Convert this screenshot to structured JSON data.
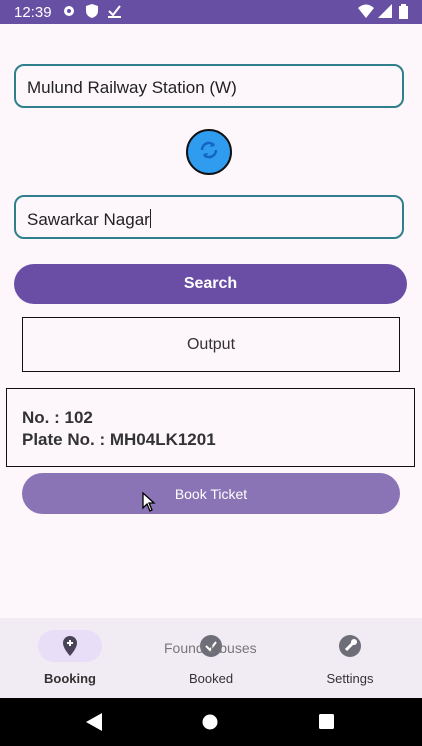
{
  "status_bar": {
    "time": "12:39",
    "icons": [
      "gear-icon",
      "shield-icon",
      "check-icon",
      "wifi-icon",
      "signal-icon",
      "battery-icon"
    ]
  },
  "form": {
    "from_value": "Mulund Railway Station (W)",
    "to_value": "Sawarkar Nagar",
    "swap_icon": "refresh-icon",
    "search_label": "Search"
  },
  "output": {
    "label": "Output"
  },
  "bus": {
    "number_line": "No. : 102",
    "plate_line": "Plate No. : MH04LK1201",
    "book_label": "Book Ticket"
  },
  "toast": {
    "text": "Found 1 buses"
  },
  "nav": {
    "items": [
      {
        "label": "Booking",
        "icon": "location-pin-icon",
        "active": true
      },
      {
        "label": "Booked",
        "icon": "check-circle-icon",
        "active": false
      },
      {
        "label": "Settings",
        "icon": "wrench-icon",
        "active": false
      }
    ]
  },
  "colors": {
    "primary": "#6a4ea6",
    "accent_border": "#2f7f8c",
    "swap_button": "#2f9cf0"
  }
}
